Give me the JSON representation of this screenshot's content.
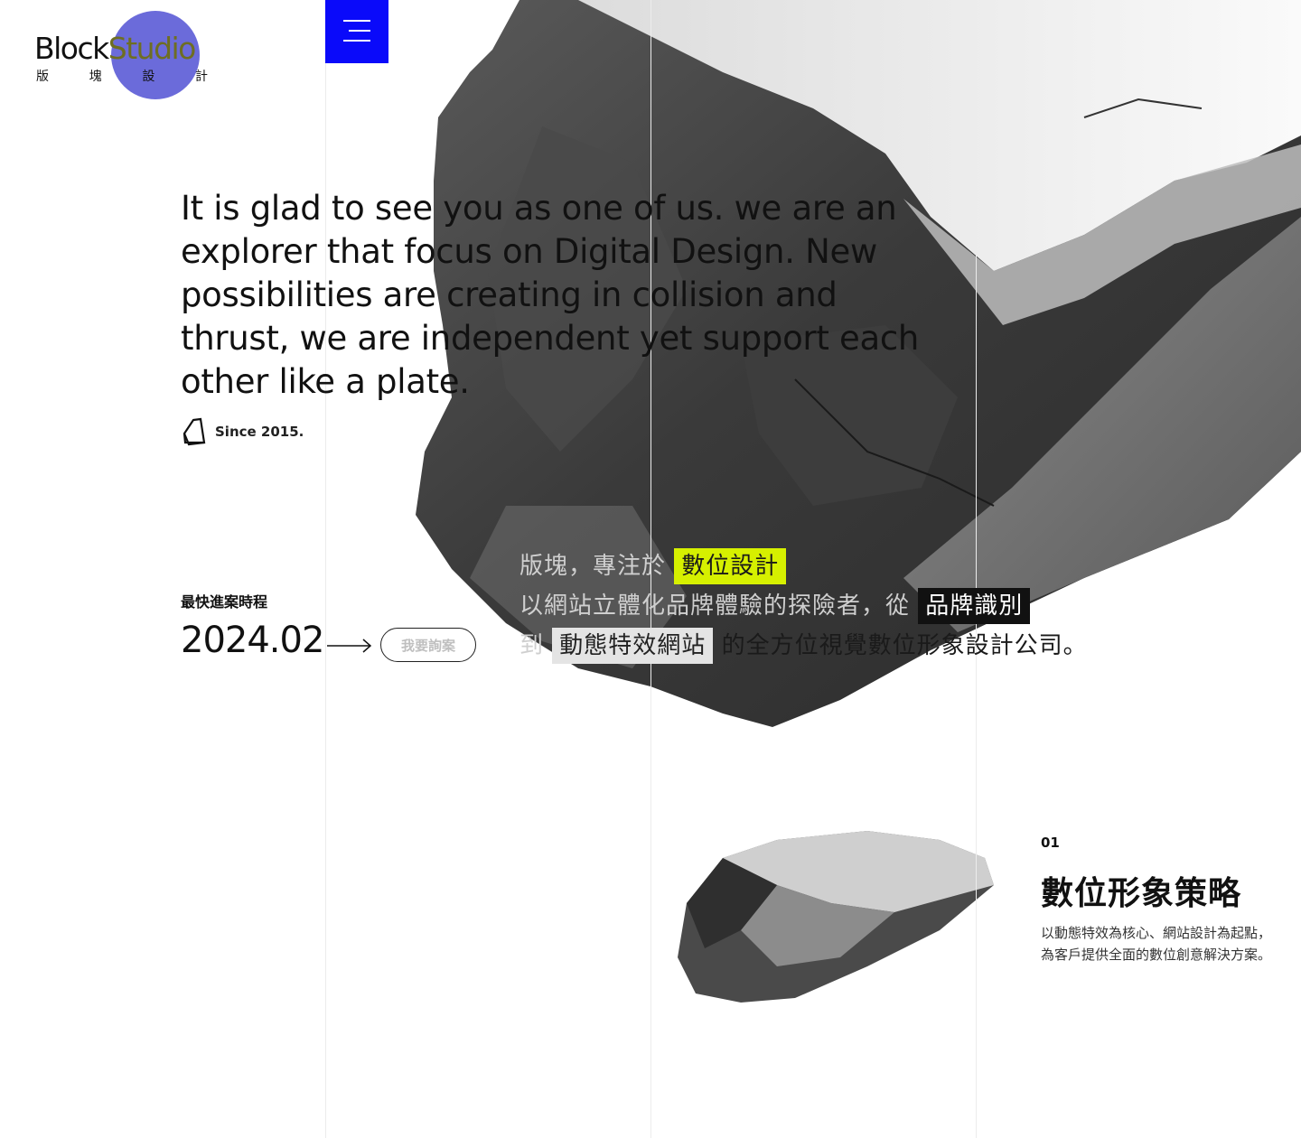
{
  "brand": {
    "logo_word_a": "Block",
    "logo_word_b": "Studio",
    "logo_cn": [
      "版",
      "塊",
      "設",
      "計"
    ]
  },
  "menu": {
    "icon": "hamburger-menu-icon"
  },
  "hero": {
    "headline_lines": [
      "It is glad to see you as one of us. we are an",
      "explorer that focus on Digital Design. New",
      "possibilities are creating in collision and",
      "thrust, we are independent yet support each",
      "other like a plate."
    ],
    "since": "Since 2015.",
    "since_icon": "block-outline-icon"
  },
  "schedule": {
    "label": "最快進案時程",
    "date": "2024.02",
    "arrow_icon": "long-arrow-right-icon",
    "inquire_label": "我要詢案"
  },
  "intro": {
    "line1_prefix": "版塊，專注於",
    "line1_tag": "數位設計",
    "line2_prefix": "以網站立體化品牌體驗的探險者，從",
    "line2_tag": "品牌識別",
    "line3_prefix": "到",
    "line3_tag": "動態特效網站",
    "line3_suffix": "的全方位視覺數位形象設計公司。",
    "colors": {
      "highlight_yellow": "#d6f000",
      "highlight_black": "#111111",
      "highlight_gray": "#e4e4e4"
    }
  },
  "service": {
    "number": "01",
    "title": "數位形象策略",
    "description": "以動態特效為核心、網站設計為起點，為客戶提供全面的數位創意解決方案。"
  },
  "colors": {
    "menu_blue": "#0a0afa",
    "logo_circle": "#5b5bd6"
  }
}
